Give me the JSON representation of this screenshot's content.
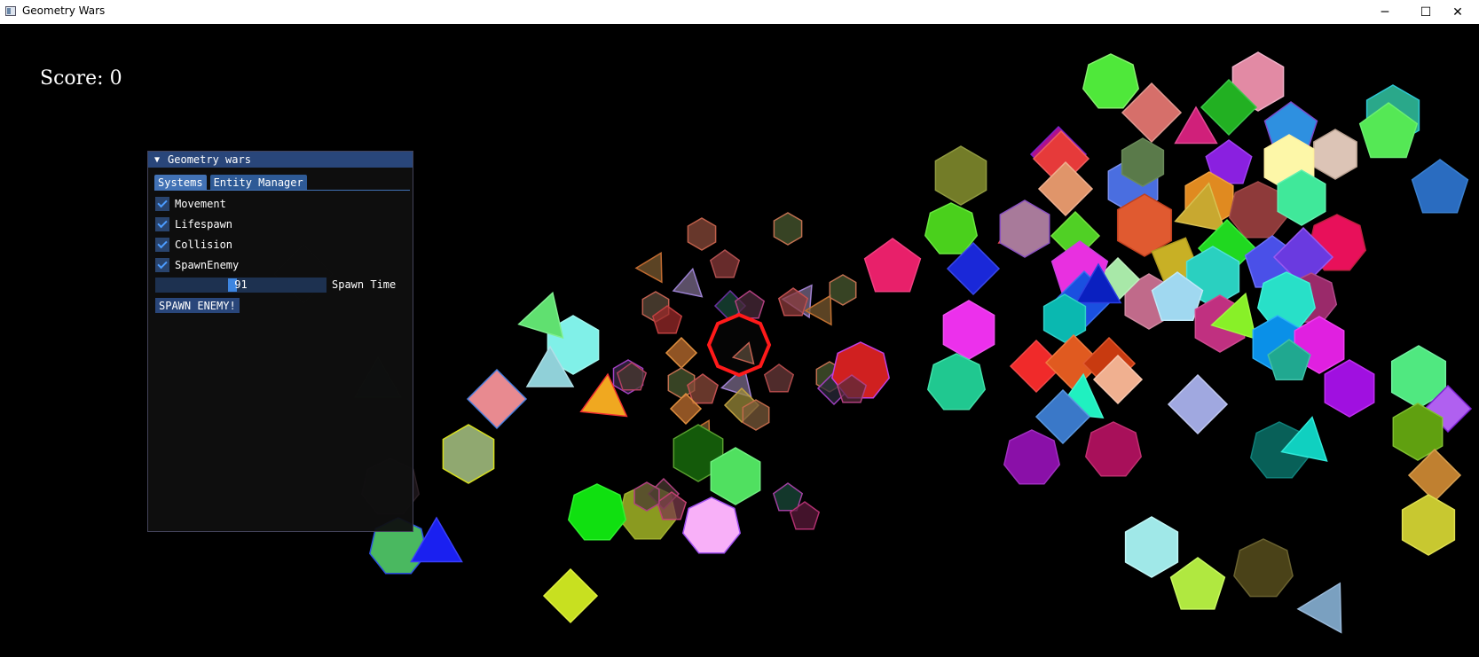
{
  "window": {
    "title": "Geometry Wars",
    "controls": {
      "minimize": "─",
      "maximize": "☐",
      "close": "✕"
    }
  },
  "hud": {
    "score_label": "Score:",
    "score_value": "0"
  },
  "panel": {
    "title": "Geometry wars",
    "tabs": [
      {
        "label": "Systems"
      },
      {
        "label": "Entity Manager"
      }
    ],
    "active_tab": "Systems",
    "systems": [
      {
        "label": "Movement",
        "checked": true
      },
      {
        "label": "Lifespawn",
        "checked": true
      },
      {
        "label": "Collision",
        "checked": true
      },
      {
        "label": "SpawnEnemy",
        "checked": true
      }
    ],
    "spawn_time": {
      "value": "91",
      "label": "Spawn Time"
    },
    "spawn_button": "SPAWN ENEMY!"
  },
  "colors": {
    "background": "#000000",
    "panel_header": "#29467a",
    "tab_active": "#4272b5",
    "player_outline": "#ff1a1a"
  }
}
